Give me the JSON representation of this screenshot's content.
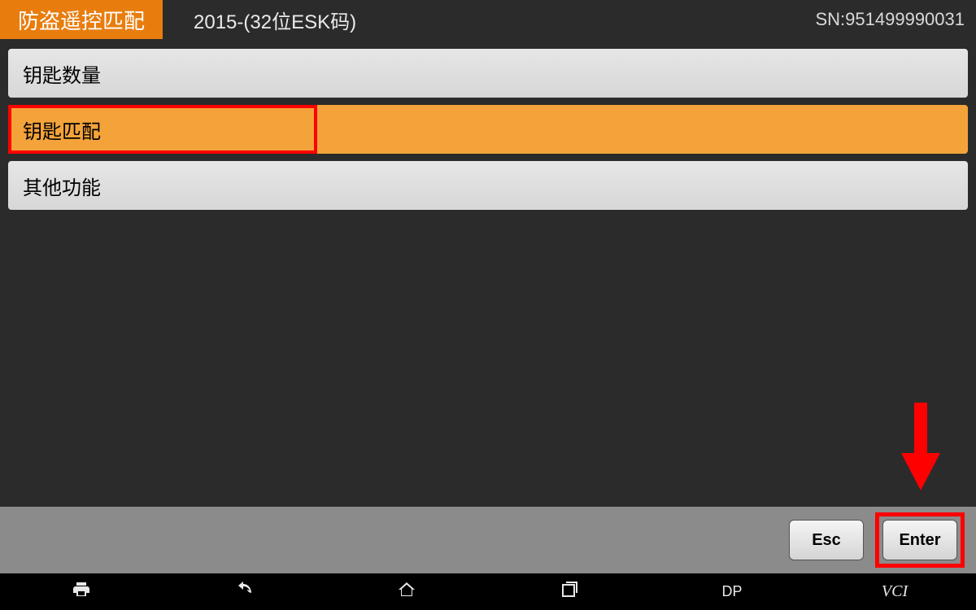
{
  "header": {
    "tag": "防盗遥控匹配",
    "model": "2015-(32位ESK码)",
    "sn": "SN:951499990031"
  },
  "menu": {
    "items": [
      {
        "label": "钥匙数量",
        "active": false
      },
      {
        "label": "钥匙匹配",
        "active": true
      },
      {
        "label": "其他功能",
        "active": false
      }
    ]
  },
  "footer": {
    "esc_label": "Esc",
    "enter_label": "Enter"
  },
  "nav": {
    "dp_label": "DP",
    "vci_label": "VCI"
  },
  "colors": {
    "accent": "#e87d0e",
    "highlight": "#f4a33a",
    "annotation": "#ff0000"
  }
}
